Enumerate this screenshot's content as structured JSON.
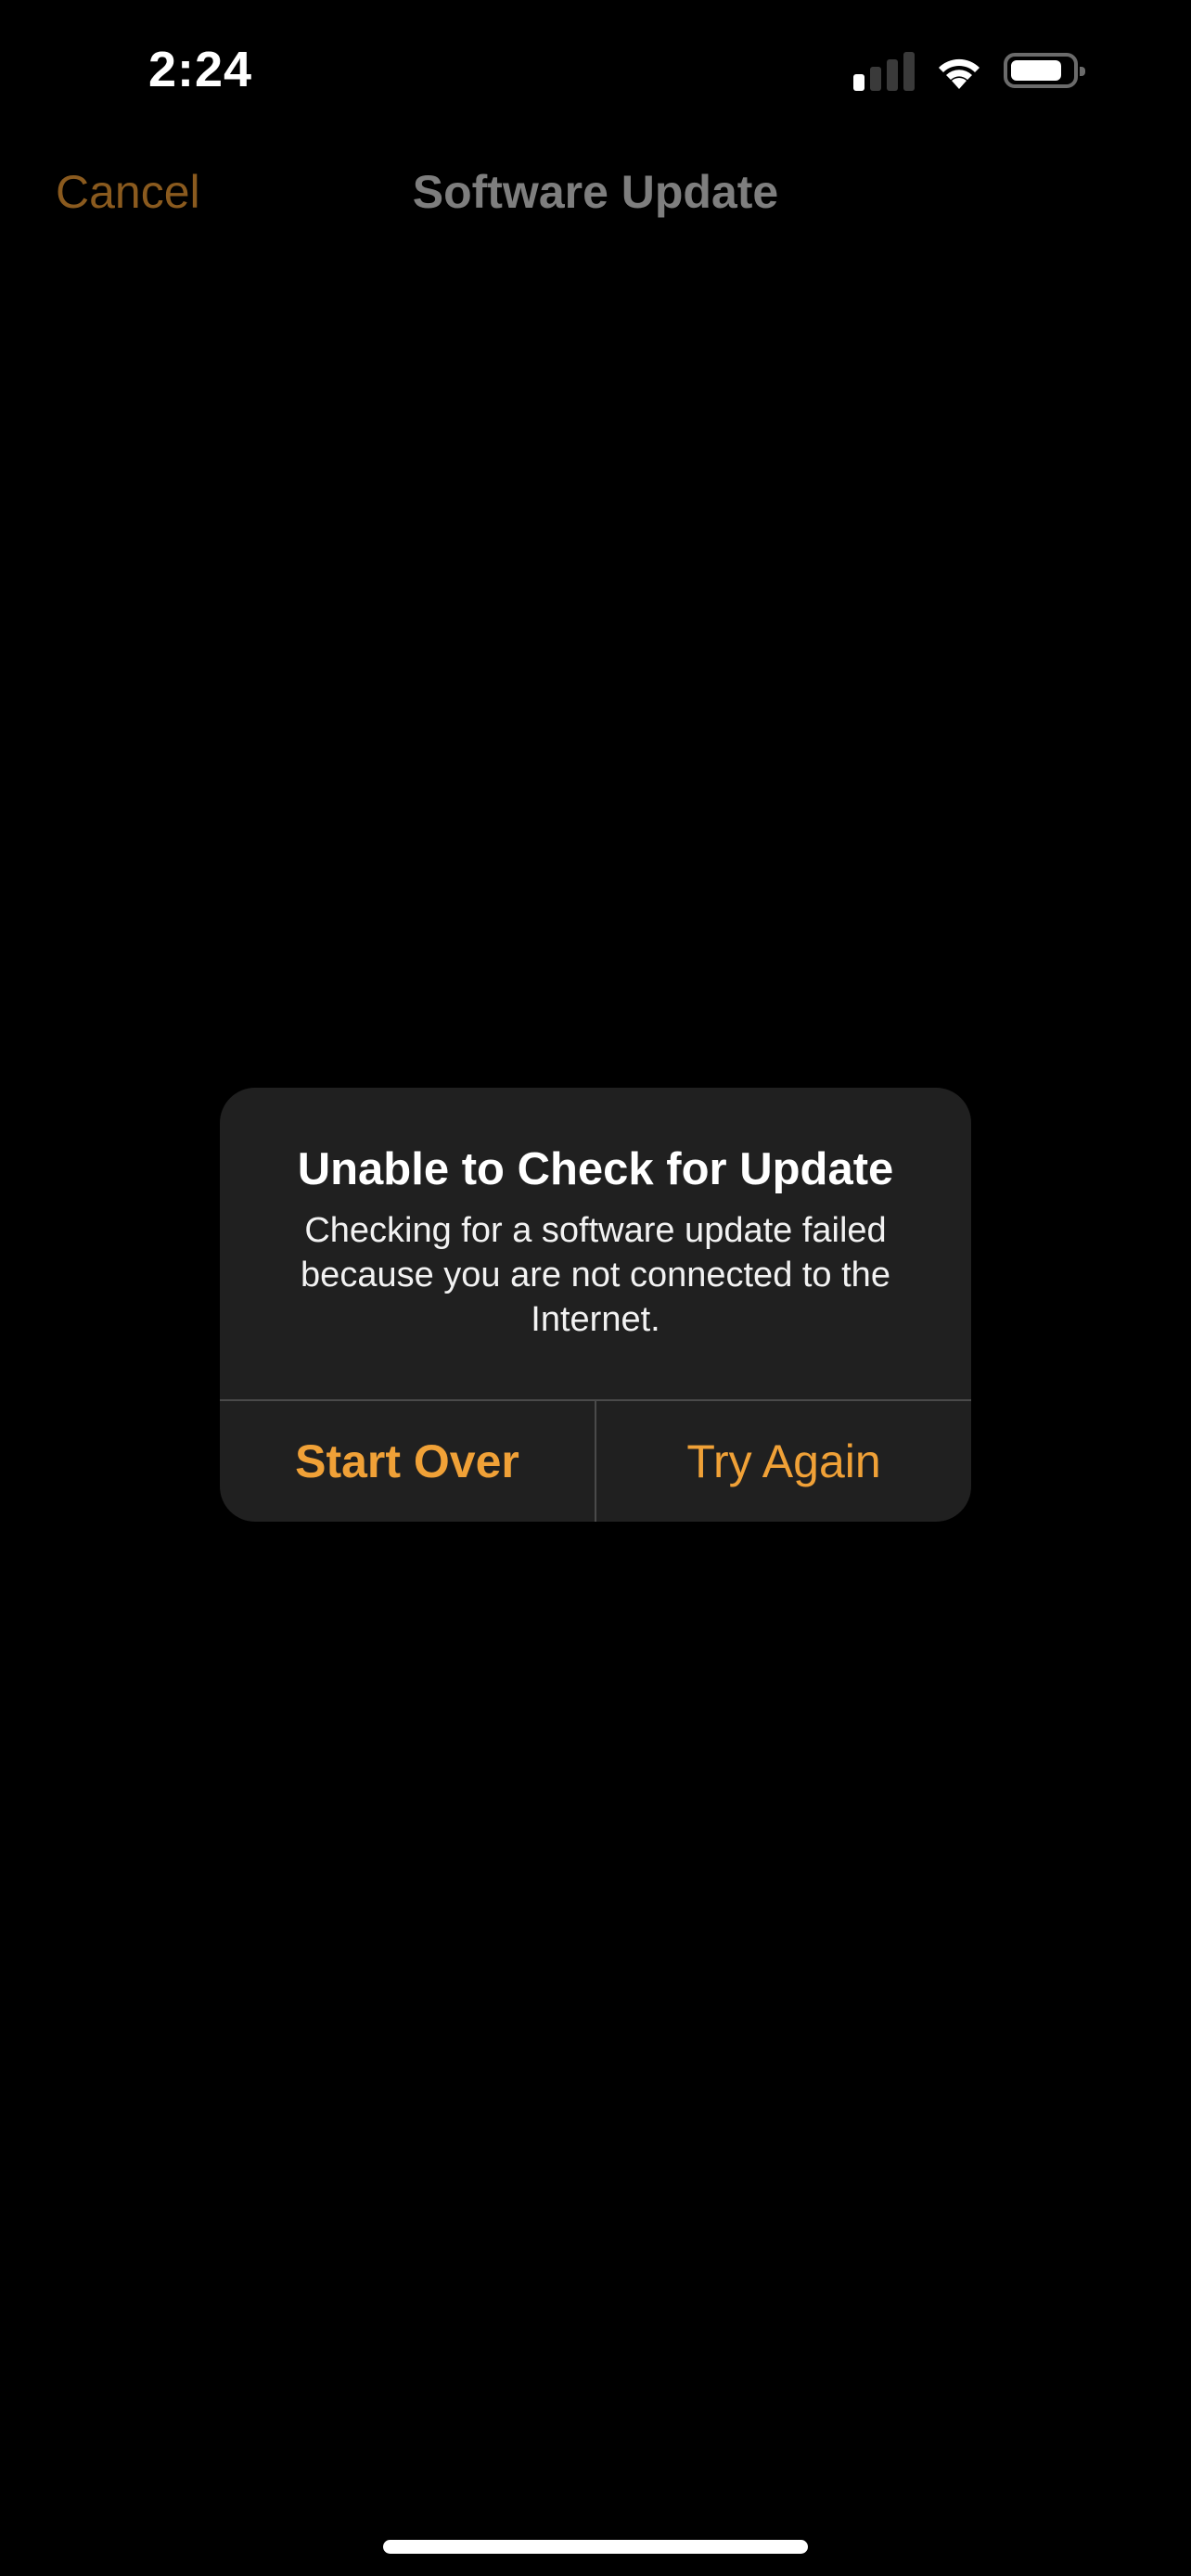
{
  "status_bar": {
    "time": "2:24",
    "signal_bars_active": 1,
    "signal_bars_total": 4,
    "wifi_icon": "wifi-icon",
    "battery_level_percent": 85
  },
  "nav": {
    "cancel_label": "Cancel",
    "title": "Software Update"
  },
  "alert": {
    "title": "Unable to Check for Update",
    "message": "Checking for a software update failed because you are not connected to the Internet.",
    "buttons": [
      {
        "label": "Start Over",
        "style": "bold"
      },
      {
        "label": "Try Again",
        "style": "regular"
      }
    ],
    "accent_color": "#f0a137"
  }
}
